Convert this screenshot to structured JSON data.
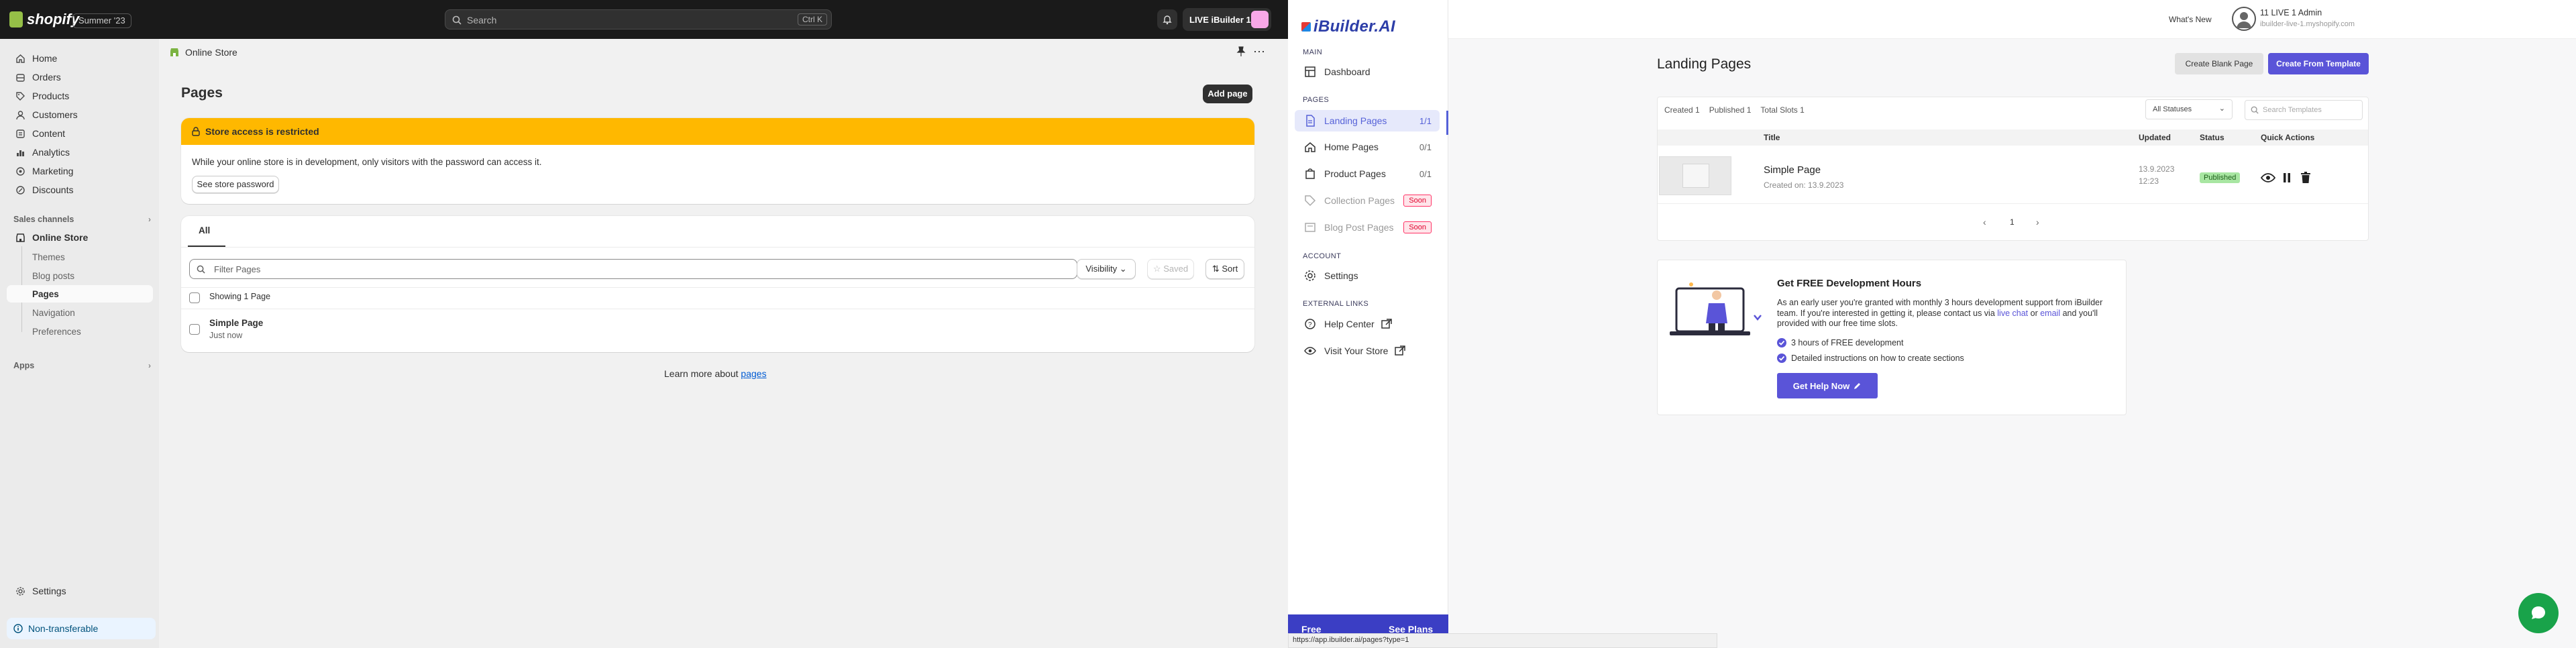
{
  "shopify": {
    "logo_text": "shopify",
    "edition_badge": "Summer '23",
    "search": {
      "placeholder": "Search",
      "shortcut": "Ctrl K"
    },
    "store_button": "LIVE iBuilder 1",
    "sidebar": {
      "items": [
        {
          "label": "Home",
          "icon": "home-icon"
        },
        {
          "label": "Orders",
          "icon": "orders-icon"
        },
        {
          "label": "Products",
          "icon": "tag-icon"
        },
        {
          "label": "Customers",
          "icon": "person-icon"
        },
        {
          "label": "Content",
          "icon": "content-icon"
        },
        {
          "label": "Analytics",
          "icon": "chart-icon"
        },
        {
          "label": "Marketing",
          "icon": "target-icon"
        },
        {
          "label": "Discounts",
          "icon": "discount-icon"
        }
      ],
      "sales_channels_label": "Sales channels",
      "online_store": "Online Store",
      "sub_items": [
        "Themes",
        "Blog posts",
        "Pages",
        "Navigation",
        "Preferences"
      ],
      "apps_label": "Apps",
      "settings": "Settings",
      "non_transferable": "Non-transferable"
    },
    "breadcrumb": "Online Store",
    "page_title": "Pages",
    "add_page": "Add page",
    "banner": {
      "title": "Store access is restricted",
      "body": "While your online store is in development, only visitors with the password can access it.",
      "button": "See store password"
    },
    "tabs": [
      "All"
    ],
    "filter_placeholder": "Filter Pages",
    "visibility": "Visibility",
    "saved": "Saved",
    "sort": "Sort",
    "showing": "Showing 1 Page",
    "rows": [
      {
        "title": "Simple Page",
        "sub": "Just now"
      }
    ],
    "learn_more_prefix": "Learn more about",
    "learn_more_link": "pages"
  },
  "ibuilder": {
    "logo": "iBuilder.AI",
    "sections": {
      "main": "MAIN",
      "pages": "PAGES",
      "account": "ACCOUNT",
      "external": "EXTERNAL LINKS"
    },
    "dashboard": "Dashboard",
    "pages": [
      {
        "label": "Landing Pages",
        "count": "1/1"
      },
      {
        "label": "Home Pages",
        "count": "0/1"
      },
      {
        "label": "Product Pages",
        "count": "0/1"
      },
      {
        "label": "Collection Pages",
        "soon": "Soon"
      },
      {
        "label": "Blog Post Pages",
        "soon": "Soon"
      }
    ],
    "settings": "Settings",
    "help_center": "Help Center",
    "visit_store": "Visit Your Store",
    "footer_left": "Free",
    "footer_right": "See Plans",
    "status_url": "https://app.ibuilder.ai/pages?type=1",
    "top": {
      "whats_new": "What's New",
      "user": "11 LIVE 1 Admin",
      "domain": "ibuilder-live-1.myshopify.com"
    },
    "title": "Landing Pages",
    "create_blank": "Create Blank Page",
    "create_template": "Create From Template",
    "stats": {
      "created": "Created 1",
      "published": "Published 1",
      "slots": "Total Slots 1"
    },
    "status_filter": "All Statuses",
    "search_placeholder": "Search Templates",
    "columns": [
      "Title",
      "Updated",
      "Status",
      "Quick Actions"
    ],
    "row": {
      "title": "Simple Page",
      "created": "Created on: 13.9.2023",
      "updated_date": "13.9.2023",
      "updated_time": "12:23",
      "status": "Published"
    },
    "pagination": {
      "page": "1"
    },
    "promo": {
      "title": "Get FREE Development Hours",
      "text_1": "As an early user you're granted with monthly 3 hours development support from iBuilder team. If you're interested in getting it, please contact us via",
      "link_chat": "live chat",
      "text_or": "or",
      "link_email": "email",
      "text_2": "and you'll provided with our free time slots.",
      "bullets": [
        "3 hours of FREE development",
        "Detailed instructions on how to create sections"
      ],
      "button": "Get Help Now"
    },
    "colors": {
      "accent": "#5a54d8",
      "published": "#a8e6a2"
    }
  }
}
